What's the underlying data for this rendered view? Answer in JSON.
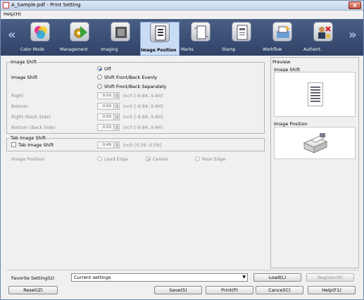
{
  "window": {
    "title": "A_Sample.pdf - Print Setting",
    "close_label": "X"
  },
  "menu": {
    "help": "Help(H)"
  },
  "toolbar": {
    "items": [
      {
        "label": "Color Mode"
      },
      {
        "label": "Management"
      },
      {
        "label": "Imaging"
      },
      {
        "label": "Image Position"
      },
      {
        "label": "Marks"
      },
      {
        "label": "Stamp"
      },
      {
        "label": "Workflow"
      },
      {
        "label": "Authent."
      }
    ],
    "prev_arrow": "«",
    "next_arrow": "»"
  },
  "image_shift": {
    "group_label": "Image Shift",
    "field_label": "Image Shift",
    "options": [
      "Off",
      "Shift Front/Back Evenly",
      "Shift Front/Back Separately"
    ],
    "selected": "Off",
    "rows": [
      {
        "label": "Right",
        "value": "0.00",
        "range": "inch [-9.84..9.84]"
      },
      {
        "label": "Bottom",
        "value": "0.00",
        "range": "inch [-9.84..9.84]"
      },
      {
        "label": "Right (Back Side)",
        "value": "0.00",
        "range": "inch [-9.84..9.84]"
      },
      {
        "label": "Bottom (Back Side)",
        "value": "0.00",
        "range": "inch [-9.84..9.84]"
      }
    ]
  },
  "tab_image_shift": {
    "group_label": "Tab Image Shift",
    "checkbox_label": "Tab Image Shift",
    "value": "0.49",
    "range": "inch [0.39..0.59]",
    "image_position_label": "Image Position",
    "positions": [
      "Lead Edge",
      "Center",
      "Rear Edge"
    ],
    "selected_position": "Center"
  },
  "preview": {
    "label": "Preview",
    "image_shift_label": "Image Shift",
    "image_position_label": "Image Position"
  },
  "favorite": {
    "label": "Favorite Setting(U)",
    "value": "Current settings",
    "load": "Load(L)",
    "register": "Register(R)"
  },
  "buttons": {
    "reset": "Reset(Z)",
    "save": "Save(S)",
    "print": "Print(P)",
    "cancel": "Cancel(C)",
    "help": "Help(F1)"
  }
}
